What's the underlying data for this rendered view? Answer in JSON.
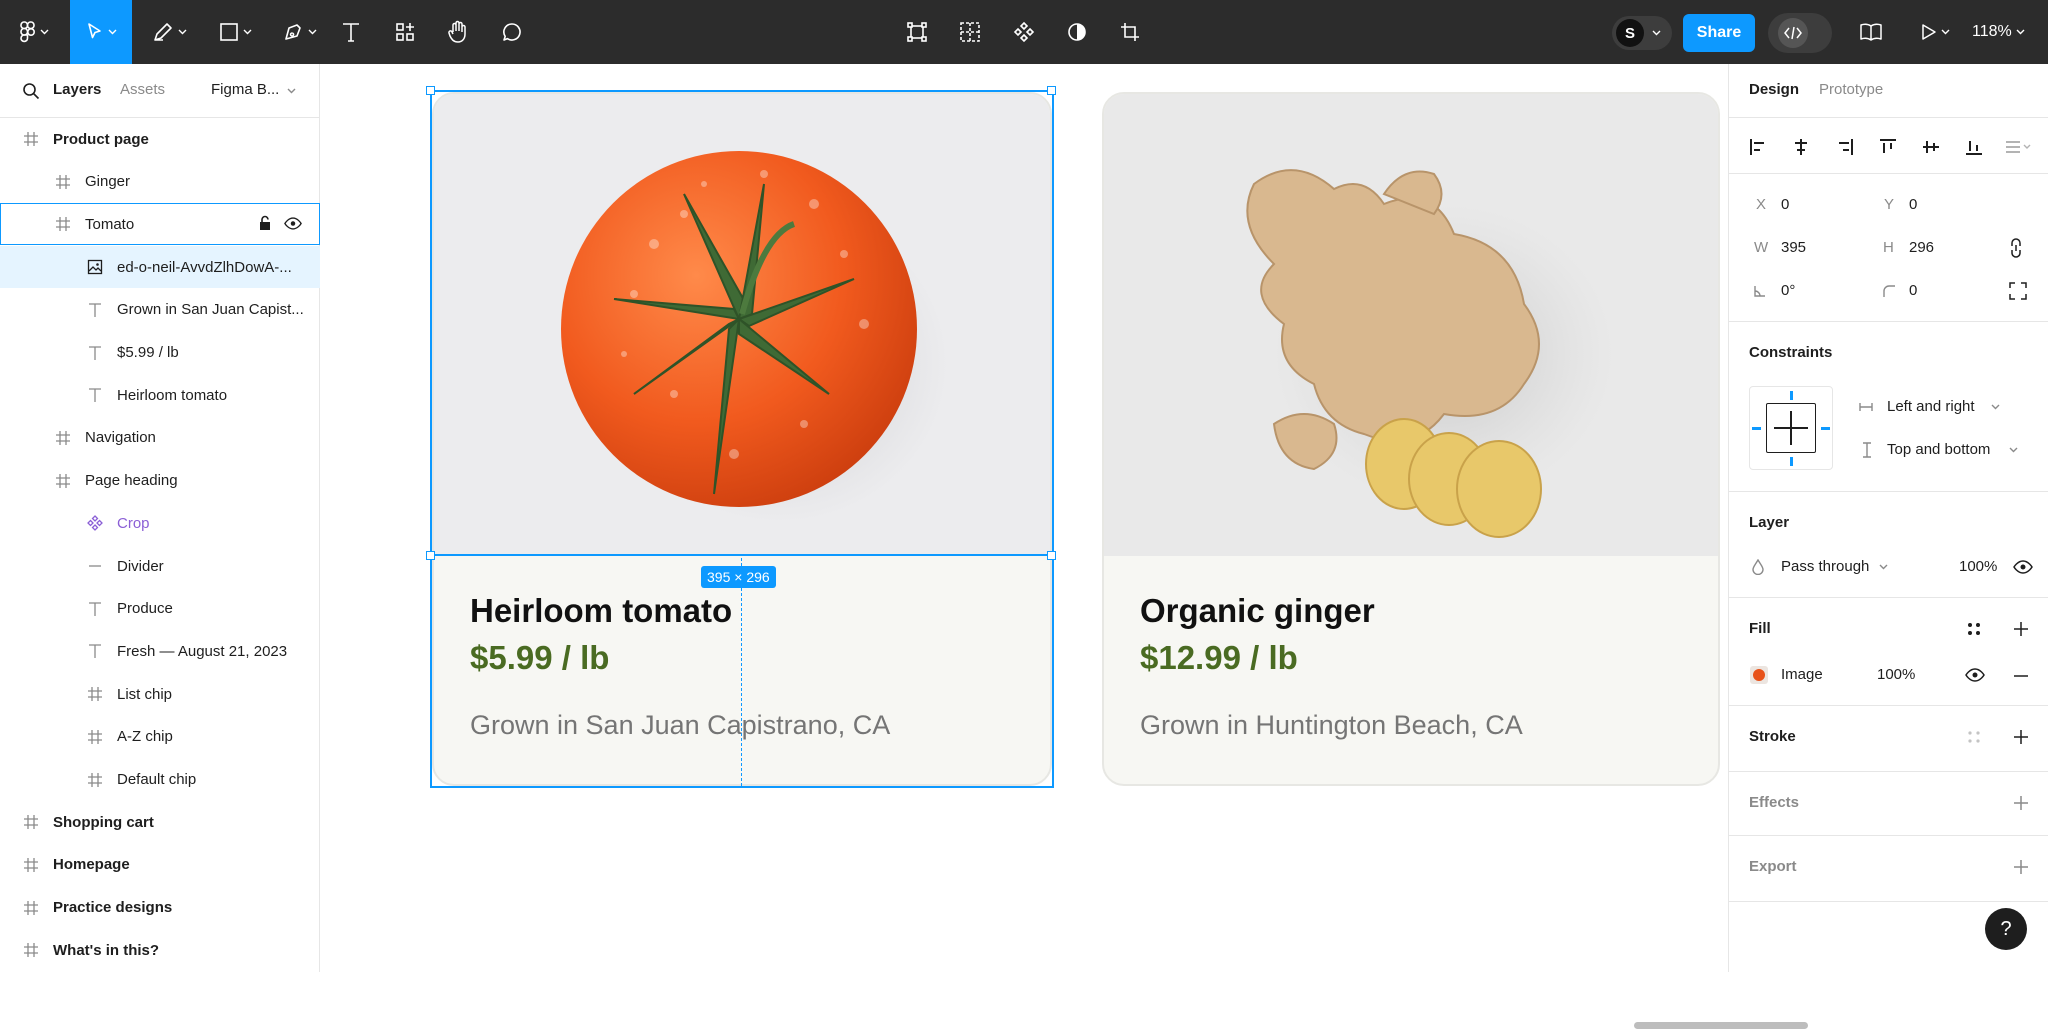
{
  "toolbar": {
    "share_label": "Share",
    "avatar_initial": "S",
    "zoom": "118%"
  },
  "left_panel": {
    "tabs": [
      "Layers",
      "Assets"
    ],
    "page_selector": "Figma B...",
    "layers": [
      {
        "label": "Product page",
        "icon": "frame-icon",
        "bold": true
      },
      {
        "label": "Ginger",
        "icon": "frame-icon"
      },
      {
        "label": "Tomato",
        "icon": "frame-icon"
      },
      {
        "label": "ed-o-neil-AvvdZlhDowA-...",
        "icon": "image-icon"
      },
      {
        "label": "Grown in San Juan Capist...",
        "icon": "text-icon"
      },
      {
        "label": "$5.99 / lb",
        "icon": "text-icon"
      },
      {
        "label": "Heirloom tomato",
        "icon": "text-icon"
      },
      {
        "label": "Navigation",
        "icon": "frame-icon"
      },
      {
        "label": "Page heading",
        "icon": "frame-icon"
      },
      {
        "label": "Crop",
        "icon": "component-icon"
      },
      {
        "label": "Divider",
        "icon": "line-icon"
      },
      {
        "label": "Produce",
        "icon": "text-icon"
      },
      {
        "label": "Fresh — August 21, 2023",
        "icon": "text-icon"
      },
      {
        "label": "List chip",
        "icon": "frame-icon"
      },
      {
        "label": "A-Z chip",
        "icon": "frame-icon"
      },
      {
        "label": "Default chip",
        "icon": "frame-icon"
      },
      {
        "label": "Shopping cart",
        "icon": "frame-icon",
        "bold": true
      },
      {
        "label": "Homepage",
        "icon": "frame-icon",
        "bold": true
      },
      {
        "label": "Practice designs",
        "icon": "frame-icon",
        "bold": true
      },
      {
        "label": "What's in this?",
        "icon": "frame-icon",
        "bold": true
      }
    ]
  },
  "canvas": {
    "cards": [
      {
        "title": "Heirloom tomato",
        "price": "$5.99 / lb",
        "location": "Grown in San Juan Capistrano, CA"
      },
      {
        "title": "Organic ginger",
        "price": "$12.99 / lb",
        "location": "Grown in Huntington Beach, CA"
      }
    ],
    "selection_dimensions": "395 × 296"
  },
  "right_panel": {
    "tabs": [
      "Design",
      "Prototype"
    ],
    "x_label": "X",
    "x_value": "0",
    "y_label": "Y",
    "y_value": "0",
    "w_label": "W",
    "w_value": "395",
    "h_label": "H",
    "h_value": "296",
    "rotation": "0°",
    "corner_radius": "0",
    "constraints": {
      "title": "Constraints",
      "horizontal": "Left and right",
      "vertical": "Top and bottom"
    },
    "layer": {
      "title": "Layer",
      "blend": "Pass through",
      "opacity": "100%"
    },
    "fill": {
      "title": "Fill",
      "type": "Image",
      "opacity": "100%"
    },
    "stroke_title": "Stroke",
    "effects_title": "Effects",
    "export_title": "Export"
  },
  "help_label": "?",
  "colors": {
    "accent": "#0d99ff",
    "toolbar_bg": "#2c2c2c",
    "price_green": "#4a6b22"
  }
}
